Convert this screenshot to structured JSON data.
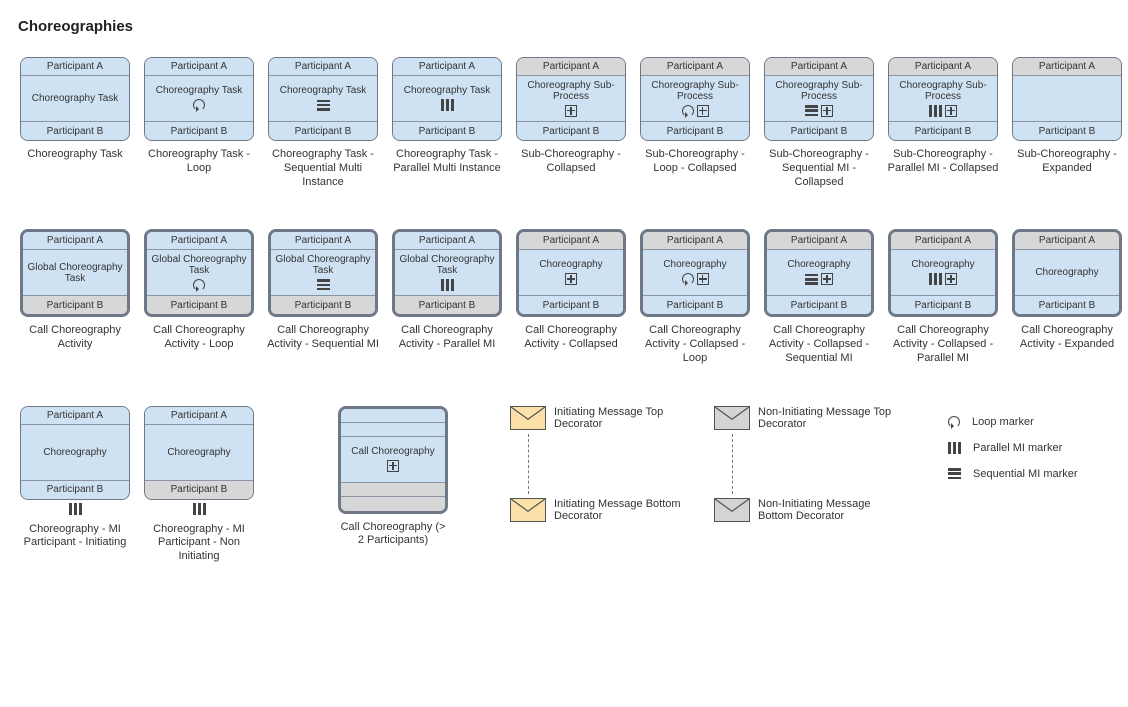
{
  "title": "Choreographies",
  "labels": {
    "pA": "Participant A",
    "pB": "Participant B",
    "choreTask": "Choreography Task",
    "choreSub": "Choreography Sub-Process",
    "globalTask": "Global Choreography Task",
    "chore": "Choreography",
    "callChore": "Call Choreography"
  },
  "captions": {
    "r1": [
      "Choreography Task",
      "Choreography Task - Loop",
      "Choreography Task - Sequential Multi Instance",
      "Choreography Task - Parallel Multi Instance",
      "Sub-Choreography - Collapsed",
      "Sub-Choreography - Loop - Collapsed",
      "Sub-Choreography - Sequential MI - Collapsed",
      "Sub-Choreography - Parallel MI - Collapsed",
      "Sub-Choreography - Expanded"
    ],
    "r2": [
      "Call Choreography Activity",
      "Call Choreography Activity - Loop",
      "Call Choreography Activity - Sequential MI",
      "Call Choreography Activity - Parallel MI",
      "Call Choreography Activity - Collapsed",
      "Call Choreography Activity - Collapsed - Loop",
      "Call Choreography Activity - Collapsed - Sequential MI",
      "Call Choreography Activity - Collapsed - Parallel MI",
      "Call Choreography Activity - Expanded"
    ],
    "r3a": "Choreography - MI Participant - Initiating",
    "r3b": "Choreography - MI Participant - Non Initiating",
    "r3c": "Call Choreography (> 2 Participants)",
    "msgInitTop": "Initiating Message Top Decorator",
    "msgInitBot": "Initiating Message Bottom Decorator",
    "msgNonTop": "Non-Initiating Message Top Decorator",
    "msgNonBot": "Non-Initiating Message Bottom Decorator",
    "legLoop": "Loop marker",
    "legPar": "Parallel MI marker",
    "legSeq": "Sequential MI marker"
  }
}
